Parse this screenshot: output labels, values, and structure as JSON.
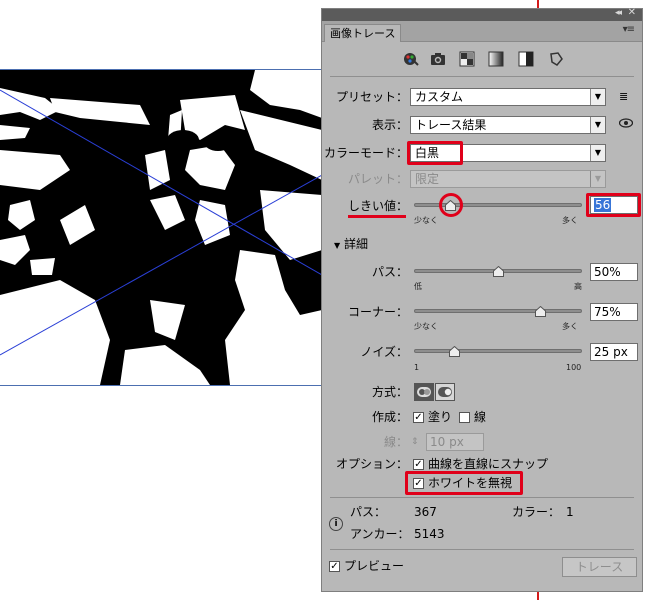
{
  "panel": {
    "tab_title": "画像トレース",
    "header_collapse": "◂◂",
    "header_close": "✕",
    "tab_flyout": "▾≡"
  },
  "presets": {
    "icons": [
      "auto-color-icon",
      "high-color-icon",
      "low-color-icon",
      "grayscale-icon",
      "black-and-white-icon",
      "outline-icon"
    ]
  },
  "fields": {
    "preset_label": "プリセット：",
    "preset_value": "カスタム",
    "view_label": "表示：",
    "view_value": "トレース結果",
    "mode_label": "カラーモード：",
    "mode_value": "白黒",
    "palette_label": "パレット：",
    "palette_value": "限定",
    "threshold_label": "しきい値：",
    "threshold_value": "56",
    "threshold_min": "少なく",
    "threshold_max": "多く"
  },
  "threshold_slider": {
    "level": 56,
    "min": 0,
    "max": 255
  },
  "advanced": {
    "section_label": "詳細",
    "paths_label": "パス：",
    "paths_value": "50%",
    "paths_min": "低",
    "paths_max": "高",
    "paths_level": 0.5,
    "corners_label": "コーナー：",
    "corners_value": "75%",
    "corners_min": "少なく",
    "corners_max": "多く",
    "corners_level": 0.75,
    "noise_label": "ノイズ：",
    "noise_value": "25 px",
    "noise_min": "1",
    "noise_max": "100",
    "noise_level": 25,
    "method_label": "方式：",
    "create_label": "作成：",
    "fills_label": "塗り",
    "fills_checked": true,
    "strokes_label": "線",
    "strokes_checked": false,
    "stroke_label": "線：",
    "stroke_value": "10 px",
    "options_label": "オプション：",
    "snap_label": "曲線を直線にスナップ",
    "snap_checked": true,
    "ignore_white_label": "ホワイトを無視",
    "ignore_white_checked": true
  },
  "info": {
    "paths_label": "パス：",
    "paths_count": "367",
    "colors_label": "カラー：",
    "colors_count": "1",
    "anchors_label": "アンカー：",
    "anchors_count": "5143"
  },
  "footer": {
    "preview_label": "プレビュー",
    "preview_checked": true,
    "trace_button": "トレース"
  },
  "colors": {
    "panel_bg": "#b8b8b8",
    "highlight_red": "#e0001a",
    "selection_blue": "#3875d7",
    "guide_blue": "#4c6fb0"
  }
}
